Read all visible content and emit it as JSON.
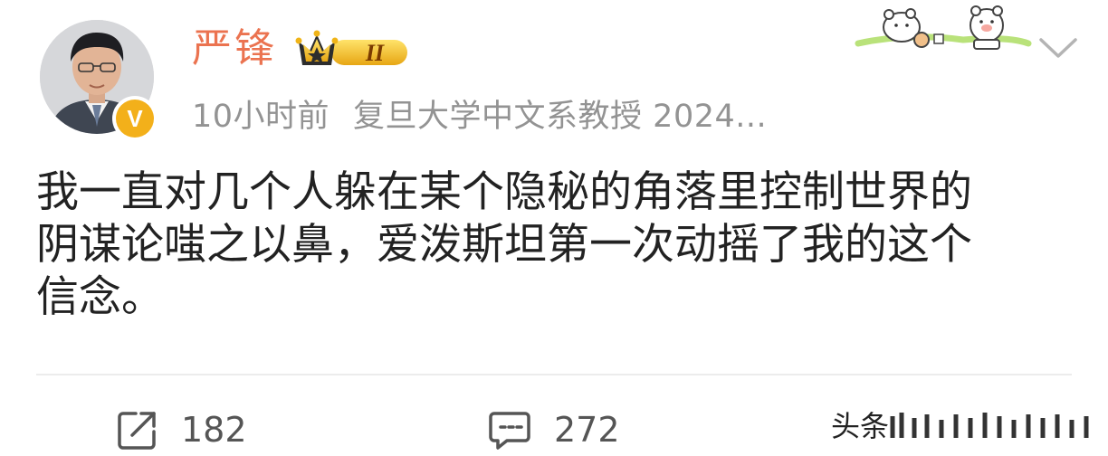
{
  "author": {
    "name": "严锋",
    "verified_badge": "V",
    "vip_level": "II",
    "vip_icon": "crown-icon"
  },
  "meta": {
    "time": "10小时前",
    "description": "复旦大学中文系教授 2024..."
  },
  "post": {
    "lines": [
      "我一直对几个人躲在某个隐秘的角落里控制世界的",
      "阴谋论嗤之以鼻，爱泼斯坦第一次动摇了我的这个",
      "信念。"
    ]
  },
  "actions": {
    "repost_count": "182",
    "comment_count": "272"
  },
  "watermark": {
    "text": "头条"
  },
  "colors": {
    "name": "#eb7350",
    "meta": "#939393",
    "text": "#222222",
    "badge": "#f3b01a"
  }
}
